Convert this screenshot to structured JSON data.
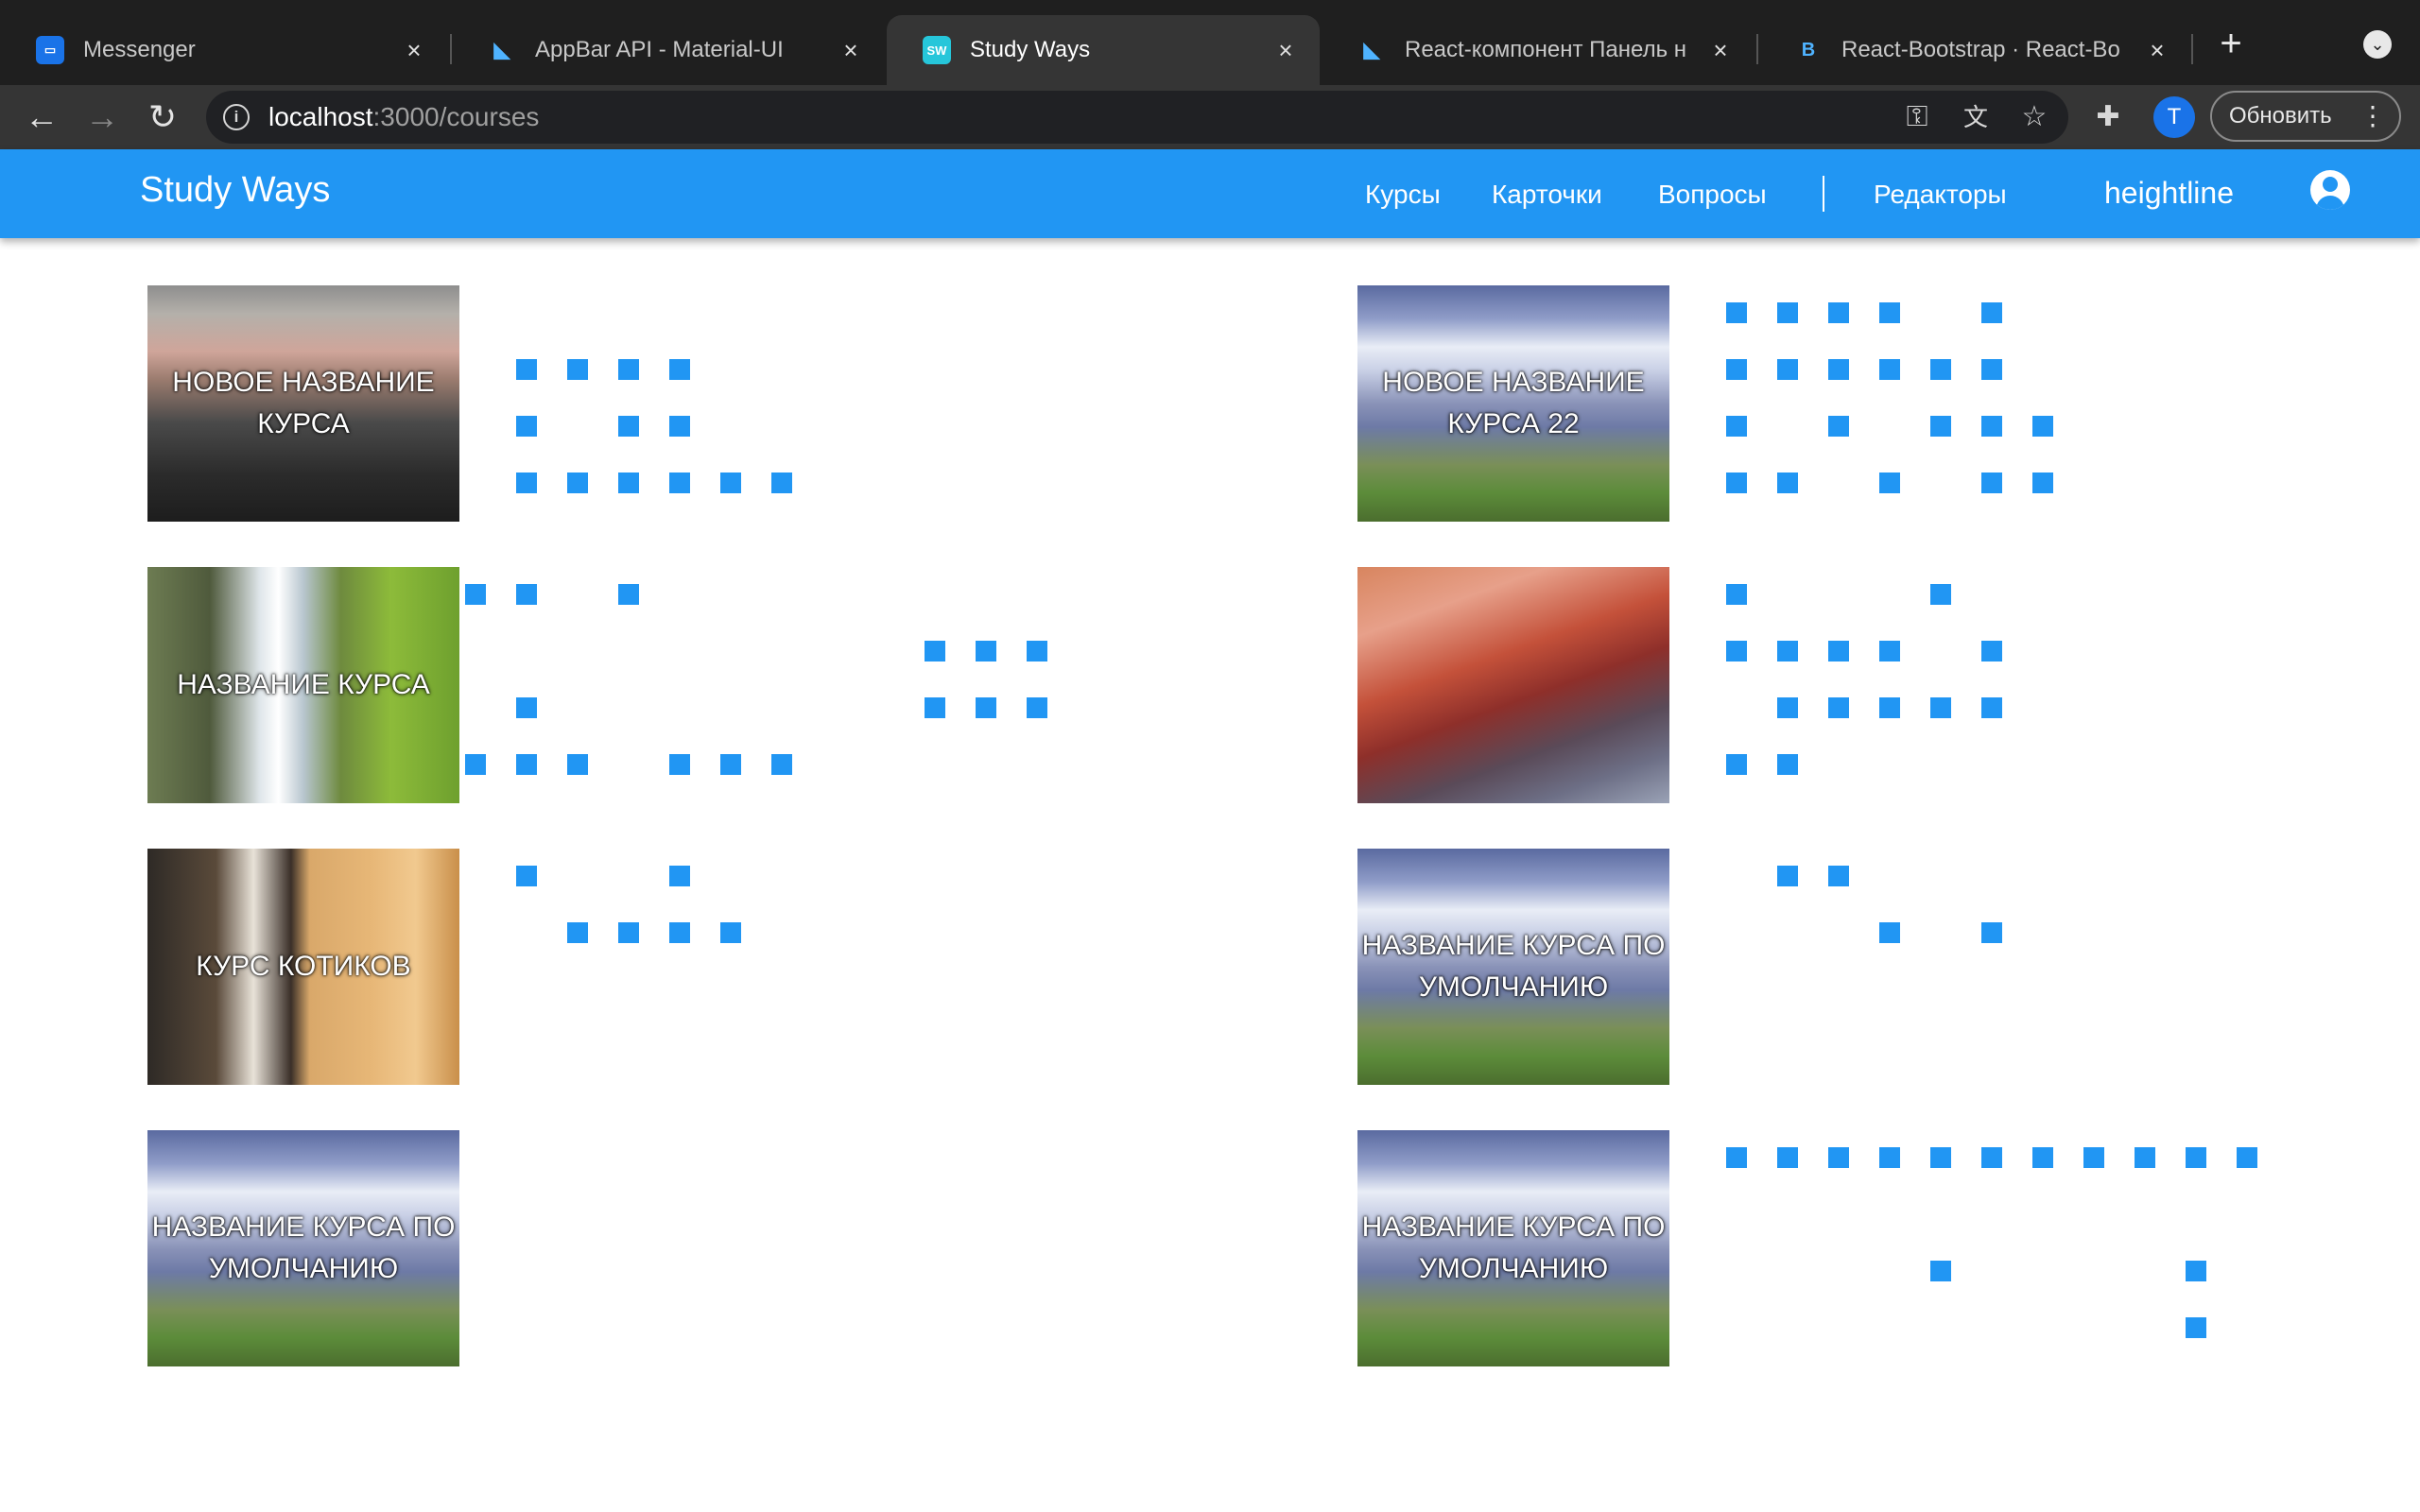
{
  "browser": {
    "tabs": [
      {
        "title": "Messenger",
        "favicon": "messenger-icon",
        "active": false
      },
      {
        "title": "AppBar API - Material-UI",
        "favicon": "material-ui-icon",
        "active": false
      },
      {
        "title": "Study Ways",
        "favicon": "sw-icon",
        "favicon_text": "SW",
        "active": true
      },
      {
        "title": "React-компонент Панель н",
        "favicon": "material-ui-icon",
        "active": false
      },
      {
        "title": "React-Bootstrap · React-Bo",
        "favicon": "bootstrap-icon",
        "active": false
      }
    ],
    "url_host": "localhost",
    "url_path": ":3000/courses",
    "update_button": "Обновить",
    "profile_initial": "T"
  },
  "app": {
    "brand": "Study Ways",
    "nav": [
      "Курсы",
      "Карточки",
      "Вопросы",
      "Редакторы"
    ],
    "username": "heightline"
  },
  "courses": [
    {
      "title": "НОВОЕ НАЗВАНИЕ КУРСА",
      "image": "mountain-dark"
    },
    {
      "title": "НОВОЕ НАЗВАНИЕ КУРСА 22",
      "image": "alpine"
    },
    {
      "title": "НАЗВАНИЕ КУРСА",
      "image": "waterfall"
    },
    {
      "title": "",
      "image": "red-mountain"
    },
    {
      "title": "КУРС КОТИКОВ",
      "image": "cats"
    },
    {
      "title": "НАЗВАНИЕ КУРСА ПО УМОЛЧАНИЮ",
      "image": "alpine"
    },
    {
      "title": "НАЗВАНИЕ КУРСА ПО УМОЛЧАНИЮ",
      "image": "alpine"
    },
    {
      "title": "НАЗВАНИЕ КУРСА ПО УМОЛЧАНИЮ",
      "image": "alpine"
    }
  ],
  "colors": {
    "accent": "#2196f3",
    "chrome_dark": "#1f1f1f",
    "chrome_toolbar": "#353535"
  }
}
